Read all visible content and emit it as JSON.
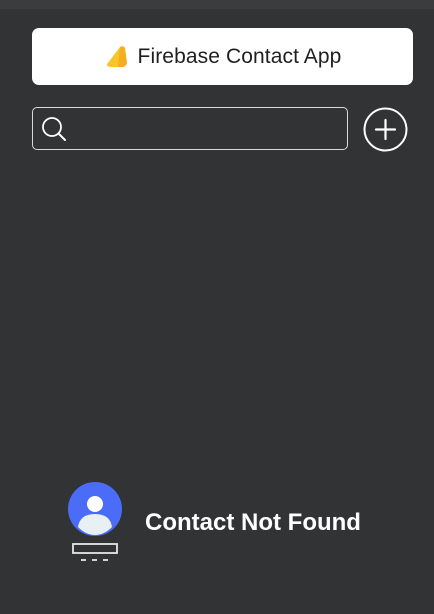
{
  "header": {
    "title": "Firebase Contact App",
    "logo_icon": "firebase-logo-icon"
  },
  "search": {
    "icon": "search-icon",
    "value": "",
    "placeholder": ""
  },
  "add_button": {
    "icon": "plus-circle-icon"
  },
  "empty_state": {
    "illustration": "contact-placeholder-icon",
    "message": "Contact Not Found"
  },
  "colors": {
    "background": "#323334",
    "card": "#ffffff",
    "accent_blue": "#4a6cf7",
    "firebase_yellow": "#f7c52b"
  }
}
